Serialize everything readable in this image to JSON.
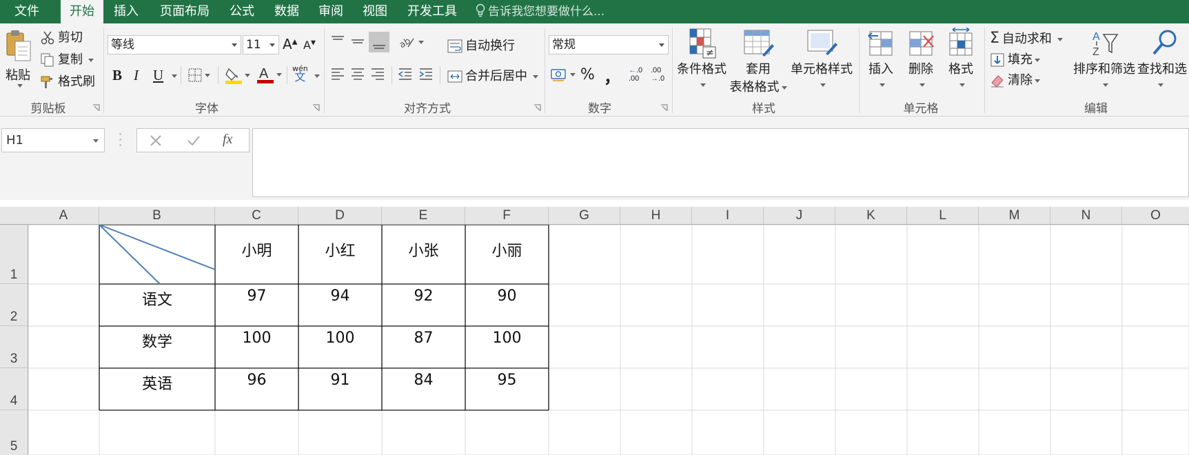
{
  "menu": {
    "tabs": [
      "文件",
      "开始",
      "插入",
      "页面布局",
      "公式",
      "数据",
      "审阅",
      "视图",
      "开发工具"
    ],
    "active_tab": "开始",
    "tell_me": "告诉我您想要做什么..."
  },
  "ribbon": {
    "clipboard": {
      "paste": "粘贴",
      "cut": "剪切",
      "copy": "复制",
      "format_painter": "格式刷",
      "label": "剪贴板"
    },
    "font": {
      "name": "等线",
      "size": "11",
      "bold": "B",
      "italic": "I",
      "underline": "U",
      "phonetic": "wén",
      "label": "字体"
    },
    "alignment": {
      "wrap_text": "自动换行",
      "merge_center": "合并后居中",
      "label": "对齐方式"
    },
    "number": {
      "format": "常规",
      "percent": "%",
      "comma": "，",
      "label": "数字"
    },
    "styles": {
      "conditional": "条件格式",
      "table_format_1": "套用",
      "table_format_2": "表格格式",
      "cell_styles": "单元格样式",
      "label": "样式"
    },
    "cells": {
      "insert": "插入",
      "delete": "删除",
      "format": "格式",
      "label": "单元格"
    },
    "editing": {
      "autosum": "自动求和",
      "fill": "填充",
      "clear": "清除",
      "sort_filter": "排序和筛选",
      "find_select": "查找和选",
      "label": "编辑"
    }
  },
  "formula_bar": {
    "name_box": "H1",
    "fx": "fx",
    "value": ""
  },
  "sheet": {
    "columns": [
      "A",
      "B",
      "C",
      "D",
      "E",
      "F",
      "G",
      "H",
      "I",
      "J",
      "K",
      "L",
      "M",
      "N",
      "O"
    ],
    "rows": [
      "1",
      "2",
      "3",
      "4",
      "5"
    ],
    "header_names": [
      "小明",
      "小红",
      "小张",
      "小丽"
    ],
    "table": [
      {
        "subject": "语文",
        "scores": [
          "97",
          "94",
          "92",
          "90"
        ]
      },
      {
        "subject": "数学",
        "scores": [
          "100",
          "100",
          "87",
          "100"
        ]
      },
      {
        "subject": "英语",
        "scores": [
          "96",
          "91",
          "84",
          "95"
        ]
      }
    ]
  },
  "colors": {
    "accent": "#217346",
    "ribbon_bg": "#f3f3f3",
    "diagonal": "#4e7fb4"
  }
}
